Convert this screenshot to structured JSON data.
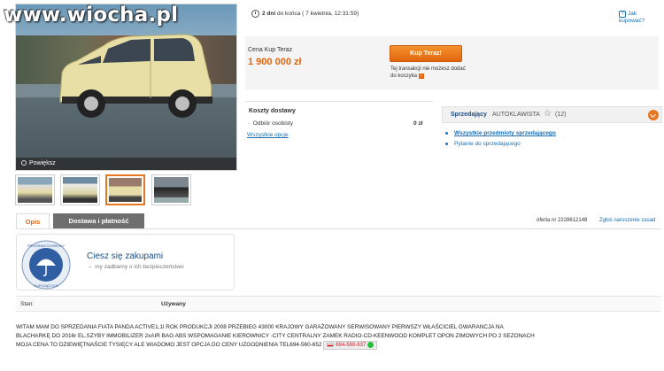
{
  "watermark": "www.wiocha.pl",
  "gallery": {
    "zoom_label": "Powiększ"
  },
  "auction": {
    "time_bold": "2 dni",
    "time_rest": "do końca ( 7 kwietnia, 12:31:59)",
    "help": "Jak kupować?"
  },
  "buy": {
    "price_label": "Cena Kup Teraz",
    "price": "1 900 000 zł",
    "button": "Kup Teraz!",
    "note": "Tej transakcji nie możesz dodać do koszyka"
  },
  "shipping": {
    "title": "Koszty dostawy",
    "row_label": "Odbiór osobisty",
    "row_value": "0 zł",
    "link": "Wszystkie opcje"
  },
  "seller": {
    "label": "Sprzedający",
    "name": "AUTOKLAWISTA",
    "count": "(12)",
    "link_items": "Wszystkie przedmioty sprzedającego",
    "link_ask": "Pytanie do sprzedającego"
  },
  "tabs": [
    {
      "label": "Opis"
    },
    {
      "label": "Dostawa i płatność"
    }
  ],
  "offer": {
    "number": "oferta nr 2228612148",
    "report": "Zgłoś naruszenie zasad"
  },
  "protection": {
    "badge_text": "PROGRAM OCHRONY KUPUJĄCYCH",
    "title": "Ciesz się zakupami",
    "subtitle": "my zadbamy o ich bezpieczeństwo"
  },
  "condition": {
    "label": "Stan:",
    "value": "Używany"
  },
  "description": {
    "line1": "WITAM MAM DO SPRZEDANIA FIATA PANDA ACTIVE1,1l ROK PRODUKCJI 2008 PRZEBIEG 43000 KRAJOWY GARAŻOWANY SERWISOWANY PIERWSZY WŁAŚCICIEL GWARANCJA NA",
    "line2": "BLACHARKĘ DO 2016r EL.SZYBY IMMOBILIZER 2xAIR BAG ABS WSPOMAGANIE KIEROWNICY -CITY CENTRALNY ZAMEK RADIO-CD-KEENWOOD KOMPLET OPON ZIMOWYCH PO 2 SEZONACH",
    "line3": "MOJA CENA TO DZIEWIĘTNAŚCIE TYSIĘCY ALE WIADOMO JEST OPCJA DO CENY UZGODNIENIA TEL694-560-652",
    "phone_chip": "694-560-637"
  }
}
